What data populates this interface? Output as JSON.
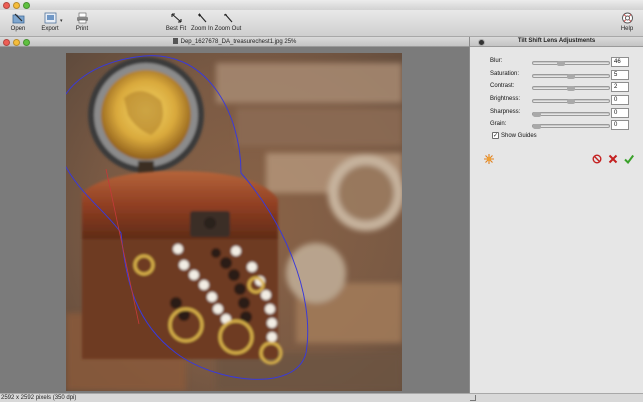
{
  "toolbar": {
    "open": "Open",
    "export": "Export",
    "print": "Print",
    "best_fit": "Best Fit",
    "zoom_in": "Zoom In",
    "zoom_out": "Zoom Out",
    "help": "Help"
  },
  "document": {
    "title": "Dep_1627678_DA_treasurechest1.jpg 25%"
  },
  "status": {
    "dimensions": "2592 x 2592 pixels (350 dpi)"
  },
  "panel": {
    "title": "Tilt Shift Lens Adjustments",
    "adjustments": [
      {
        "label": "Blur:",
        "value": "46",
        "level": 0.35
      },
      {
        "label": "Saturation:",
        "value": "5",
        "level": 0.5
      },
      {
        "label": "Contrast:",
        "value": "2",
        "level": 0.5
      },
      {
        "label": "Brightness:",
        "value": "0",
        "level": 0.5
      },
      {
        "label": "Sharpness:",
        "value": "0",
        "level": 0.0
      },
      {
        "label": "Grain:",
        "value": "0",
        "level": 0.0
      }
    ],
    "show_guides": {
      "label": "Show Guides",
      "checked": true
    }
  },
  "colors": {
    "guide": "#3a3ad8",
    "reset": "#e08020",
    "remove": "#c42020",
    "cancel": "#c42020",
    "apply": "#3aa12a"
  }
}
